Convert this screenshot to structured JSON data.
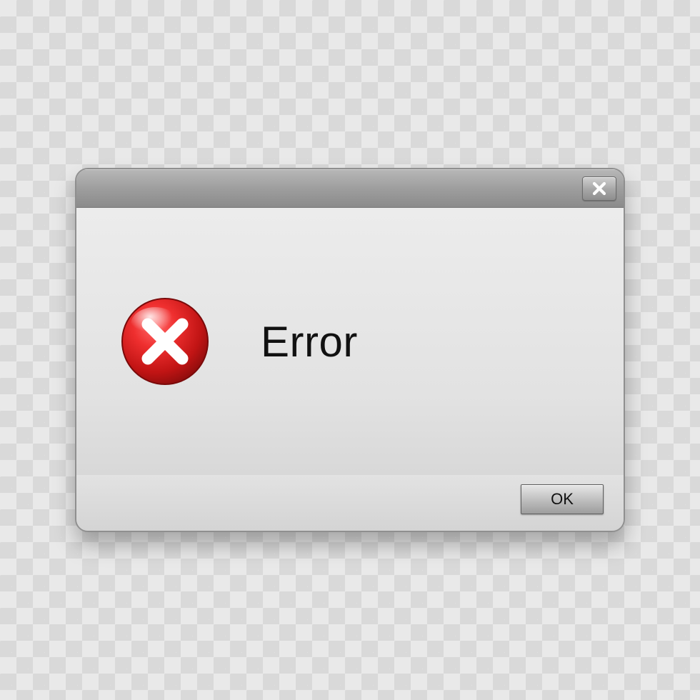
{
  "dialog": {
    "message": "Error",
    "ok_label": "OK",
    "icon_name": "error-cross-icon",
    "close_name": "close-icon"
  }
}
